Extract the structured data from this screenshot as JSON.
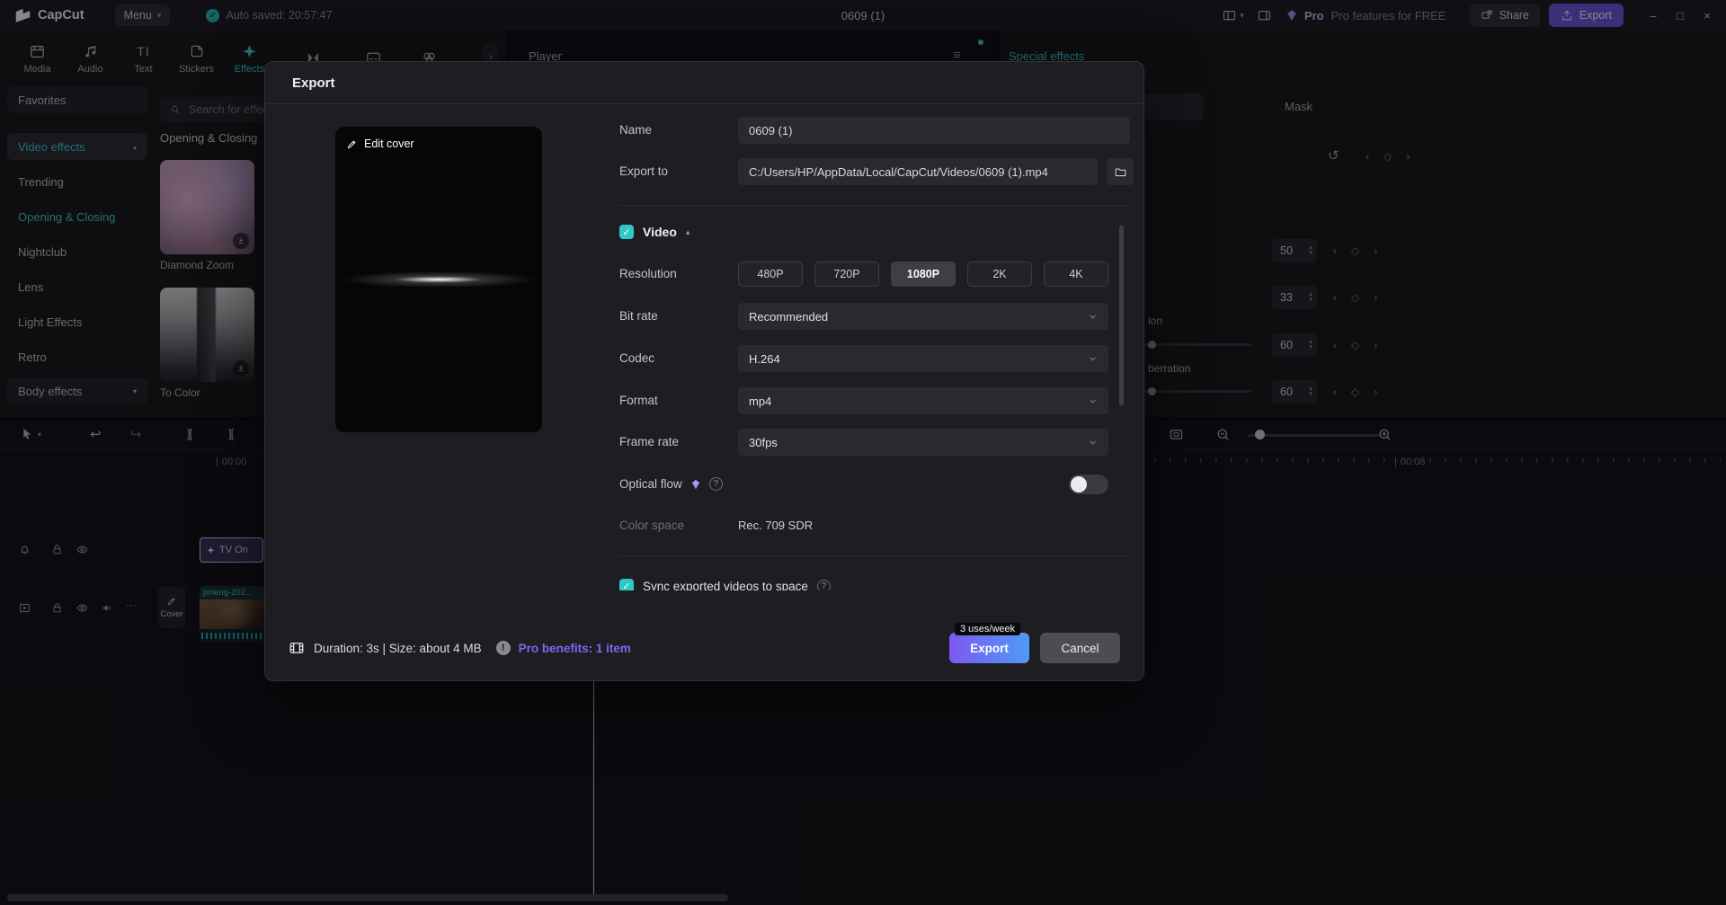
{
  "icons": {
    "chevron_down": "▾",
    "chevron_up": "▴",
    "panel_arrow": "›",
    "undo": "↩",
    "redo": "↪",
    "split": "][",
    "dots": "···",
    "hamburger": "≡",
    "reset": "↺",
    "prev": "‹",
    "next": "›",
    "keyframe": "◇",
    "check": "✓",
    "minimize": "–",
    "maximize": "□",
    "close": "×",
    "help": "?",
    "info": "!",
    "text_tool": "TI",
    "tick": "|"
  },
  "titlebar": {
    "logo": "CapCut",
    "menu_label": "Menu",
    "autosave": "Auto saved: 20:57:47",
    "project_title": "0609 (1)",
    "pro_badge": "Pro",
    "pro_promo": "Pro features for FREE",
    "share_label": "Share",
    "export_label": "Export"
  },
  "ribbon": {
    "tabs": [
      {
        "label": "Media"
      },
      {
        "label": "Audio"
      },
      {
        "label": "Text"
      },
      {
        "label": "Stickers"
      },
      {
        "label": "Effects"
      }
    ]
  },
  "sidebar": {
    "items": [
      {
        "label": "Favorites"
      },
      {
        "label": "Video effects"
      },
      {
        "label": "Trending"
      },
      {
        "label": "Opening & Closing"
      },
      {
        "label": "Nightclub"
      },
      {
        "label": "Lens"
      },
      {
        "label": "Light Effects"
      },
      {
        "label": "Retro"
      },
      {
        "label": "Body effects"
      }
    ]
  },
  "effects_library": {
    "search_placeholder": "Search for effect",
    "section_title": "Opening & Closing",
    "items": [
      {
        "name": "Diamond Zoom"
      },
      {
        "name": "To Color"
      }
    ]
  },
  "player": {
    "title": "Player"
  },
  "inspector": {
    "header_tab": "Special effects",
    "mask_tab": "Mask",
    "rows": [
      {
        "label": "",
        "value": "50"
      },
      {
        "label": "",
        "value": "33"
      },
      {
        "label": "ion",
        "value": "60"
      },
      {
        "label": "berration",
        "value": "60"
      }
    ]
  },
  "timeline": {
    "ruler_start": "00:00",
    "ruler_end": "00:08",
    "effect_clip_label": "TV On",
    "video_clip_label": "jimeng-202...",
    "cover_button_label": "Cover"
  },
  "export_dialog": {
    "title": "Export",
    "edit_cover": "Edit cover",
    "name_label": "Name",
    "name_value": "0609 (1)",
    "export_to_label": "Export to",
    "export_to_value": "C:/Users/HP/AppData/Local/CapCut/Videos/0609 (1).mp4",
    "video_section": "Video",
    "resolution_label": "Resolution",
    "resolutions": [
      "480P",
      "720P",
      "1080P",
      "2K",
      "4K"
    ],
    "resolution_selected": "1080P",
    "bitrate_label": "Bit rate",
    "bitrate_value": "Recommended",
    "codec_label": "Codec",
    "codec_value": "H.264",
    "format_label": "Format",
    "format_value": "mp4",
    "framerate_label": "Frame rate",
    "framerate_value": "30fps",
    "optical_flow_label": "Optical flow",
    "colorspace_label": "Color space",
    "colorspace_value": "Rec. 709 SDR",
    "sync_label": "Sync exported videos to space",
    "footer": {
      "summary": "Duration: 3s | Size: about 4 MB",
      "pro_benefits": "Pro benefits: 1 item",
      "uses_badge": "3 uses/week",
      "export_button": "Export",
      "cancel_button": "Cancel"
    }
  }
}
